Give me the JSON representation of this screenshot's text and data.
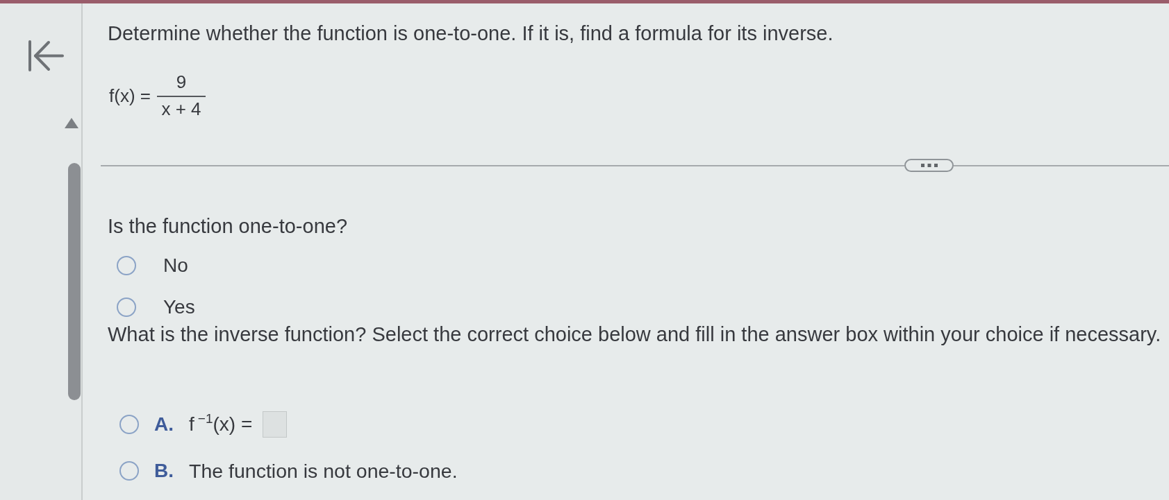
{
  "question": {
    "instruction": "Determine whether the function is one-to-one. If it is, find a formula for its inverse.",
    "function": {
      "lhs": "f(x) =",
      "numerator": "9",
      "denominator": "x + 4"
    }
  },
  "part_1": {
    "prompt": "Is the function one-to-one?",
    "options": [
      {
        "label": "No",
        "selected": false
      },
      {
        "label": "Yes",
        "selected": false
      }
    ]
  },
  "part_2": {
    "prompt": "What is the inverse function? Select the correct choice below and fill in the answer box within your choice if necessary.",
    "choices": [
      {
        "letter": "A.",
        "kind": "formula",
        "selected": false,
        "text": "f$^{−1}$(x) ="
      },
      {
        "letter": "B.",
        "kind": "statement",
        "selected": false,
        "text": "The function is not one-to-one."
      }
    ]
  }
}
